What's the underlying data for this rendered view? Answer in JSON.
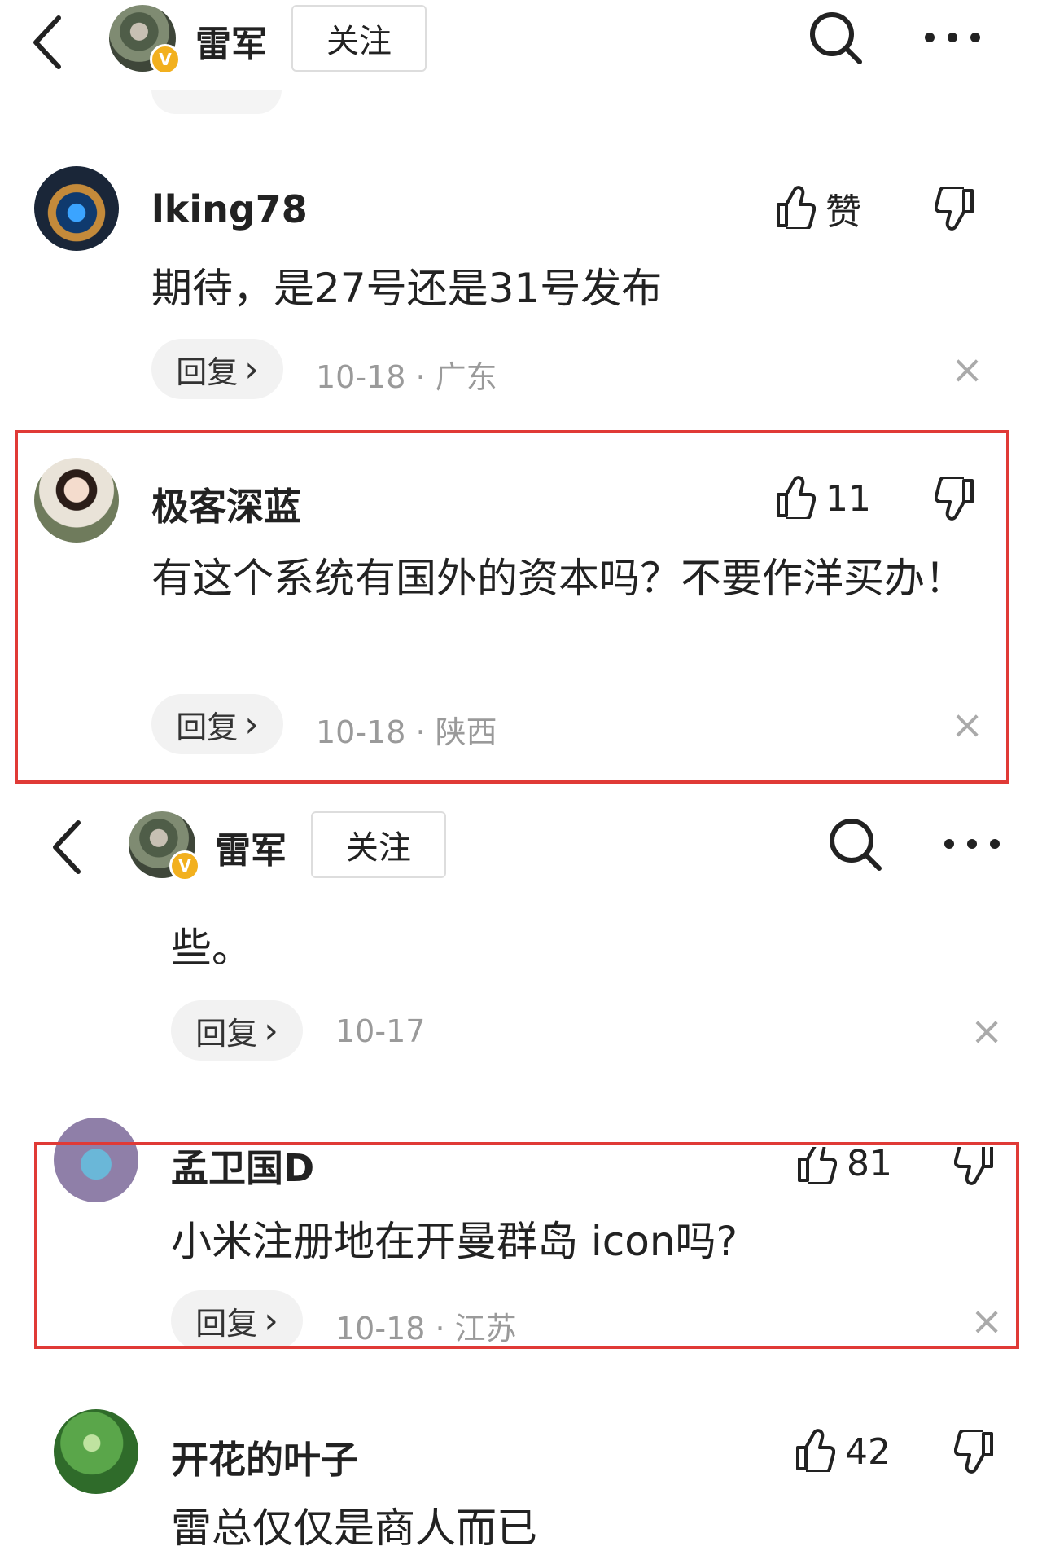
{
  "header1": {
    "author": "雷军",
    "follow_label": "关注"
  },
  "header2": {
    "author": "雷军",
    "follow_label": "关注"
  },
  "comments": [
    {
      "username": "lking78",
      "like_label": "赞",
      "text": "期待，是27号还是31号发布",
      "reply_label": "回复",
      "meta": "10-18 · 广东"
    },
    {
      "username": "极客深蓝",
      "like_count": "11",
      "text": "有这个系统有国外的资本吗？不要作洋买办！",
      "reply_label": "回复",
      "meta": "10-18 · 陕西"
    },
    {
      "text": "些。",
      "reply_label": "回复",
      "meta": "10-17"
    },
    {
      "username": "孟卫国D",
      "like_count": "81",
      "text": "小米注册地在开曼群岛 icon吗?",
      "reply_label": "回复",
      "meta": "10-18 · 江苏"
    },
    {
      "username": "开花的叶子",
      "like_count": "42",
      "text": "雷总仅仅是商人而已"
    }
  ],
  "icons": {
    "close": "×",
    "chevron": "›",
    "verified": "V"
  },
  "colors": {
    "highlight": "#e03a36",
    "verified": "#f2b01e"
  }
}
